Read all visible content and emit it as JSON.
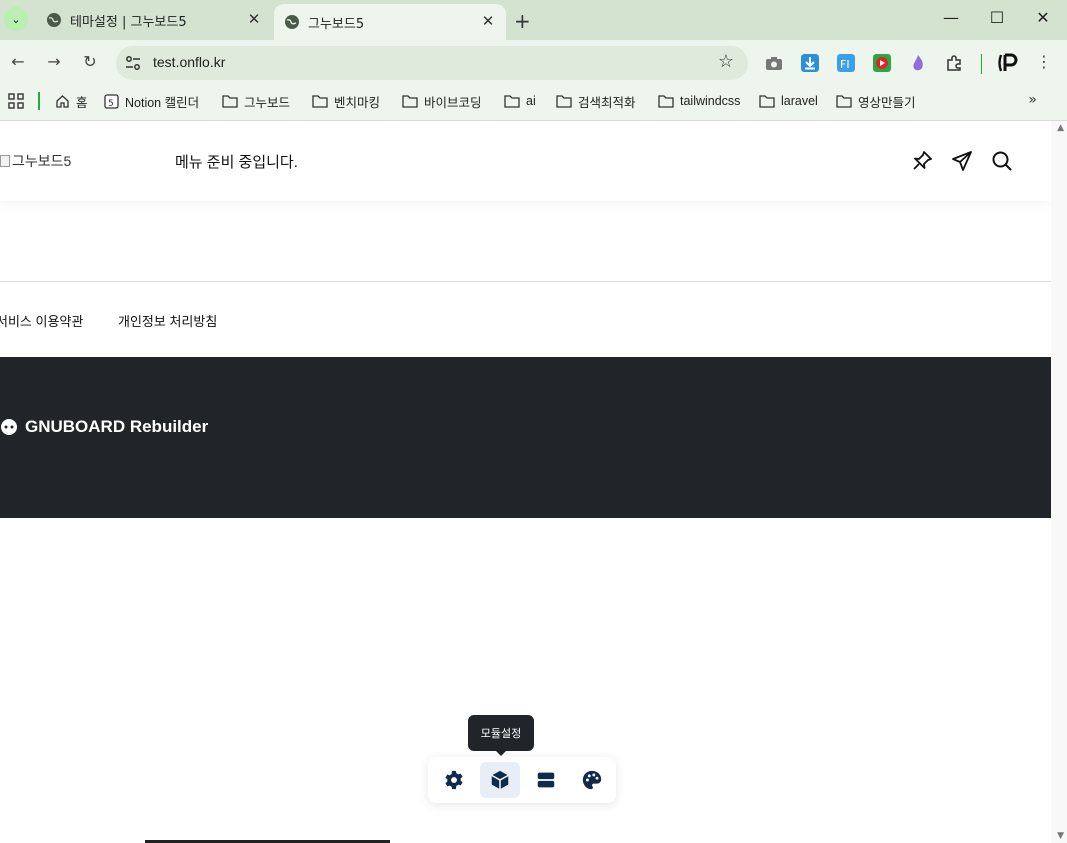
{
  "browser": {
    "tabs": [
      {
        "title": "테마설정 | 그누보드5",
        "active": false
      },
      {
        "title": "그누보드5",
        "active": true
      }
    ],
    "url": "test.onflo.kr",
    "bookmarks": [
      {
        "label": "홈",
        "icon": "home-icon"
      },
      {
        "label": "Notion 캘린더",
        "icon": "notion-icon"
      },
      {
        "label": "그누보드",
        "icon": "folder-icon"
      },
      {
        "label": "벤치마킹",
        "icon": "folder-icon"
      },
      {
        "label": "바이브코딩",
        "icon": "folder-icon"
      },
      {
        "label": "ai",
        "icon": "folder-icon"
      },
      {
        "label": "검색최적화",
        "icon": "folder-icon"
      },
      {
        "label": "tailwindcss",
        "icon": "folder-icon"
      },
      {
        "label": "laravel",
        "icon": "folder-icon"
      },
      {
        "label": "영상만들기",
        "icon": "folder-icon"
      }
    ]
  },
  "site": {
    "logo_alt": "그누보드5",
    "menu_message": "메뉴 준비 중입니다.",
    "footer_links": [
      "서비스 이용약관",
      "개인정보 처리방침"
    ],
    "brand": "GNUBOARD Rebuilder",
    "tooltip": "모듈설정",
    "dock_buttons": [
      {
        "icon": "gear-icon",
        "active": false
      },
      {
        "icon": "cube-icon",
        "active": true
      },
      {
        "icon": "layout-rows-icon",
        "active": false
      },
      {
        "icon": "palette-icon",
        "active": false
      }
    ]
  },
  "colors": {
    "tabstrip": "#d3e3d0",
    "toolbar": "#eef5ec",
    "dark_footer": "#212529",
    "accent_navy": "#0f2a4a"
  }
}
